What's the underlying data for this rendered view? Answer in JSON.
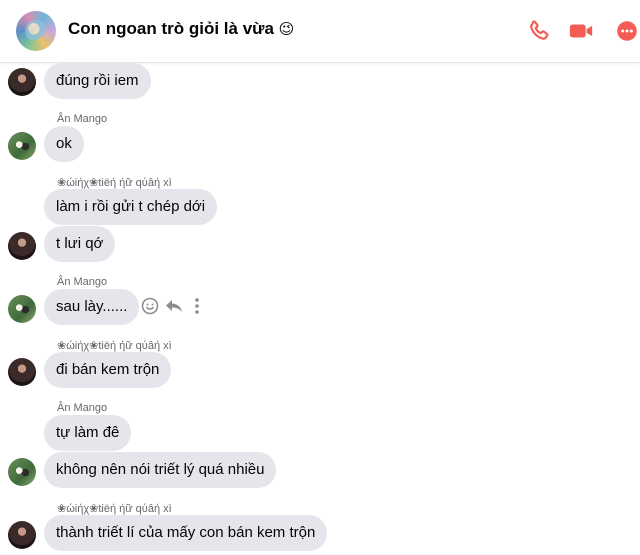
{
  "header": {
    "title": "Con ngoan trò giỏi là vừa",
    "emoji": "😉",
    "accent_color": "#f25c54",
    "icons": [
      "group-avatar",
      "phone-icon",
      "video-icon",
      "more-icon"
    ]
  },
  "messages": [
    {
      "sender_label": "",
      "text": "đúng rồi iem",
      "avatar": "dark"
    },
    {
      "sender_label": "Ân Mango",
      "text": "ok",
      "avatar": "green"
    },
    {
      "sender_label": "❀ώiήχ❀tiёή ήữ qύâή xì",
      "text": "làm i rồi gửi t chép dới",
      "avatar": ""
    },
    {
      "sender_label": "",
      "text": "t lưi qớ",
      "avatar": "dark"
    },
    {
      "sender_label": "Ân Mango",
      "text": "sau lày......",
      "avatar": "green"
    },
    {
      "sender_label": "❀ώiήχ❀tiёή ήữ qύâή xì",
      "text": "đi bán kem trộn",
      "avatar": "dark"
    },
    {
      "sender_label": "Ân Mango",
      "text": "tự làm đê",
      "avatar": ""
    },
    {
      "sender_label": "",
      "text": "không nên nói triết lý quá nhiều",
      "avatar": "green"
    },
    {
      "sender_label": "❀ώiήχ❀tiёή ήữ qύâή xì",
      "text": "thành triết lí của mấy con bán kem trộn",
      "avatar": "dark"
    }
  ],
  "hover_actions": [
    "react-icon",
    "reply-icon",
    "more-options-icon"
  ]
}
